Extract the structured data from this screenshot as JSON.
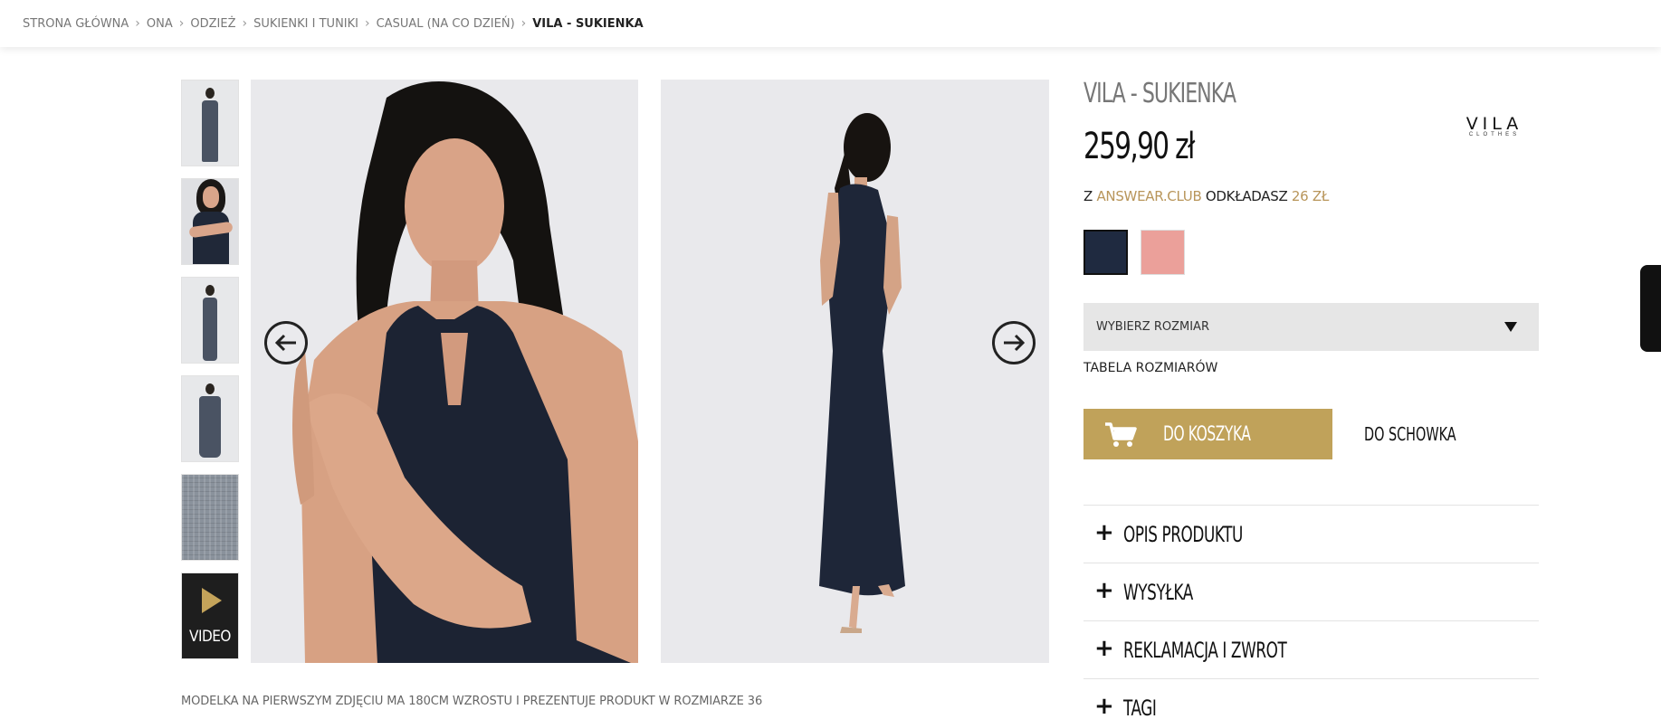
{
  "breadcrumb": [
    {
      "label": "STRONA GŁÓWNA"
    },
    {
      "label": "ONA"
    },
    {
      "label": "ODZIEŻ"
    },
    {
      "label": "SUKIENKI I TUNIKI"
    },
    {
      "label": "CASUAL (NA CO DZIEŃ)"
    },
    {
      "label": "VILA - SUKIENKA"
    }
  ],
  "gallery": {
    "video_label": "VIDEO",
    "caption": "MODELKA NA PIERWSZYM ZDJĘCIU MA 180CM WZROSTU I PREZENTUJE PRODUKT W ROZMIARZE 36"
  },
  "product": {
    "title": "VILA - SUKIENKA",
    "price": "259,90 zł",
    "brand": {
      "name": "VILA",
      "sub": "CLOTHES"
    },
    "club": {
      "prefix": "Z",
      "club_name": "ANSWEAR.CLUB",
      "middle": "ODKŁADASZ",
      "amount": "26 ZŁ"
    },
    "colors": [
      "#1f2a40",
      "#eba09a"
    ],
    "size_select": {
      "label": "WYBIERZ ROZMIAR"
    },
    "size_chart_link": "TABELA ROZMIARÓW",
    "add_to_cart": "DO KOSZYKA",
    "wishlist": "DO SCHOWKA",
    "accordion": [
      {
        "label": "OPIS PRODUKTU"
      },
      {
        "label": "WYSYŁKA"
      },
      {
        "label": "REKLAMACJA I ZWROT"
      },
      {
        "label": "TAGI"
      }
    ]
  },
  "colors": {
    "accent_gold": "#c0a25a",
    "club_gold": "#b8955a",
    "dress_navy": "#1f2a40"
  }
}
